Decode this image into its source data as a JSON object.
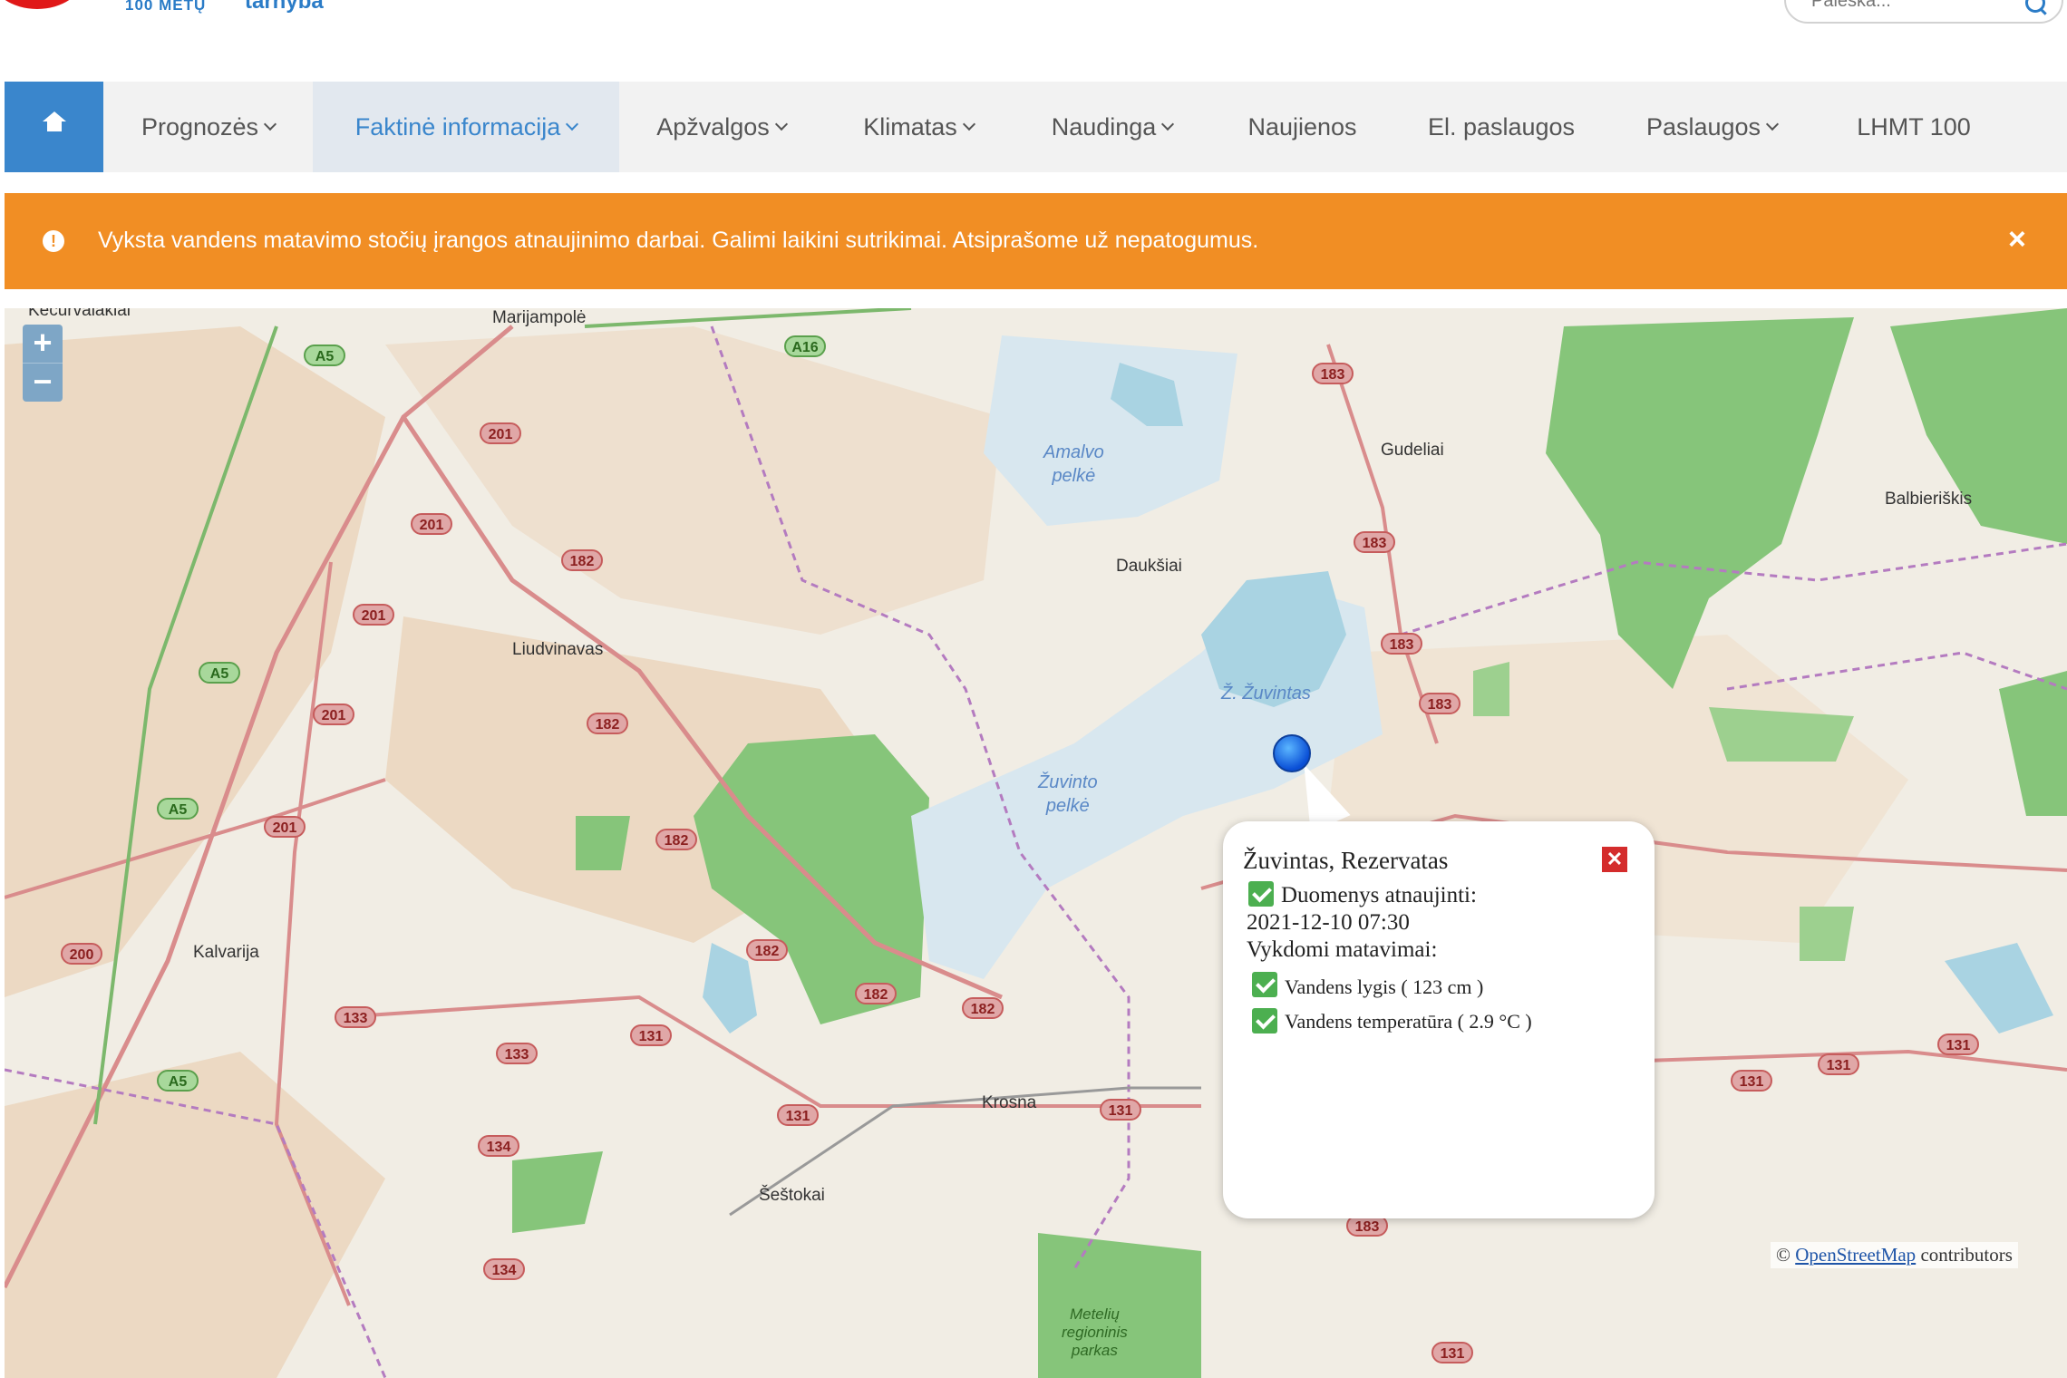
{
  "header": {
    "logo_sub": "100 METŲ",
    "logo_text": "tarnyba",
    "search_placeholder": "Paieška..."
  },
  "nav": {
    "items": [
      {
        "label": "Prognozės"
      },
      {
        "label": "Faktinė informacija"
      },
      {
        "label": "Apžvalgos"
      },
      {
        "label": "Klimatas"
      },
      {
        "label": "Naudinga"
      },
      {
        "label": "Naujienos"
      },
      {
        "label": "El. paslaugos"
      },
      {
        "label": "Paslaugos"
      },
      {
        "label": "LHMT 100"
      }
    ]
  },
  "alert": {
    "icon": "info-icon",
    "text": "Vyksta vandens matavimo stočių įrangos atnaujinimo darbai. Galimi laikini sutrikimai. Atsiprašome už nepatogumus.",
    "close": "×"
  },
  "map": {
    "zoom_in": "+",
    "zoom_out": "−",
    "places": [
      "Marijampolė",
      "Gudeliai",
      "Balbieriškis",
      "Daukšiai",
      "Liudvinavas",
      "Kalvarija",
      "Krosna",
      "Šeštokai",
      "Kecurvalakiai"
    ],
    "water": {
      "amalvo_1": "Amalvo",
      "amalvo_2": "pelkė",
      "zuvintas": "Ž. Žuvintas",
      "zuvinto_1": "Žuvinto",
      "zuvinto_2": "pelkė"
    },
    "park": [
      "Metelių",
      "regioninis",
      "parkas"
    ],
    "roads": [
      "A5",
      "A5",
      "A5",
      "A5",
      "A16",
      "201",
      "201",
      "201",
      "201",
      "201",
      "182",
      "182",
      "182",
      "182",
      "182",
      "182",
      "183",
      "183",
      "183",
      "183",
      "183",
      "131",
      "131",
      "131",
      "131",
      "131",
      "131",
      "131",
      "133",
      "133",
      "134",
      "134",
      "200"
    ],
    "attribution_prefix": "©",
    "attribution_link": "OpenStreetMap",
    "attribution_suffix": "contributors"
  },
  "popup": {
    "title": "Žuvintas, Rezervatas",
    "close": "✕",
    "updated_label": "Duomenys atnaujinti:",
    "updated_value": "2021-12-10 07:30",
    "measurements_label": "Vykdomi matavimai:",
    "level": "Vandens lygis ( 123 cm )",
    "temperature": "Vandens temperatūra ( 2.9 °C )"
  },
  "colors": {
    "nav_blue": "#3a86cc",
    "alert_orange": "#f18e24",
    "map_bg": "#f1ede4",
    "forest_green": "#86c57a",
    "water_blue": "#a9d3e2"
  }
}
